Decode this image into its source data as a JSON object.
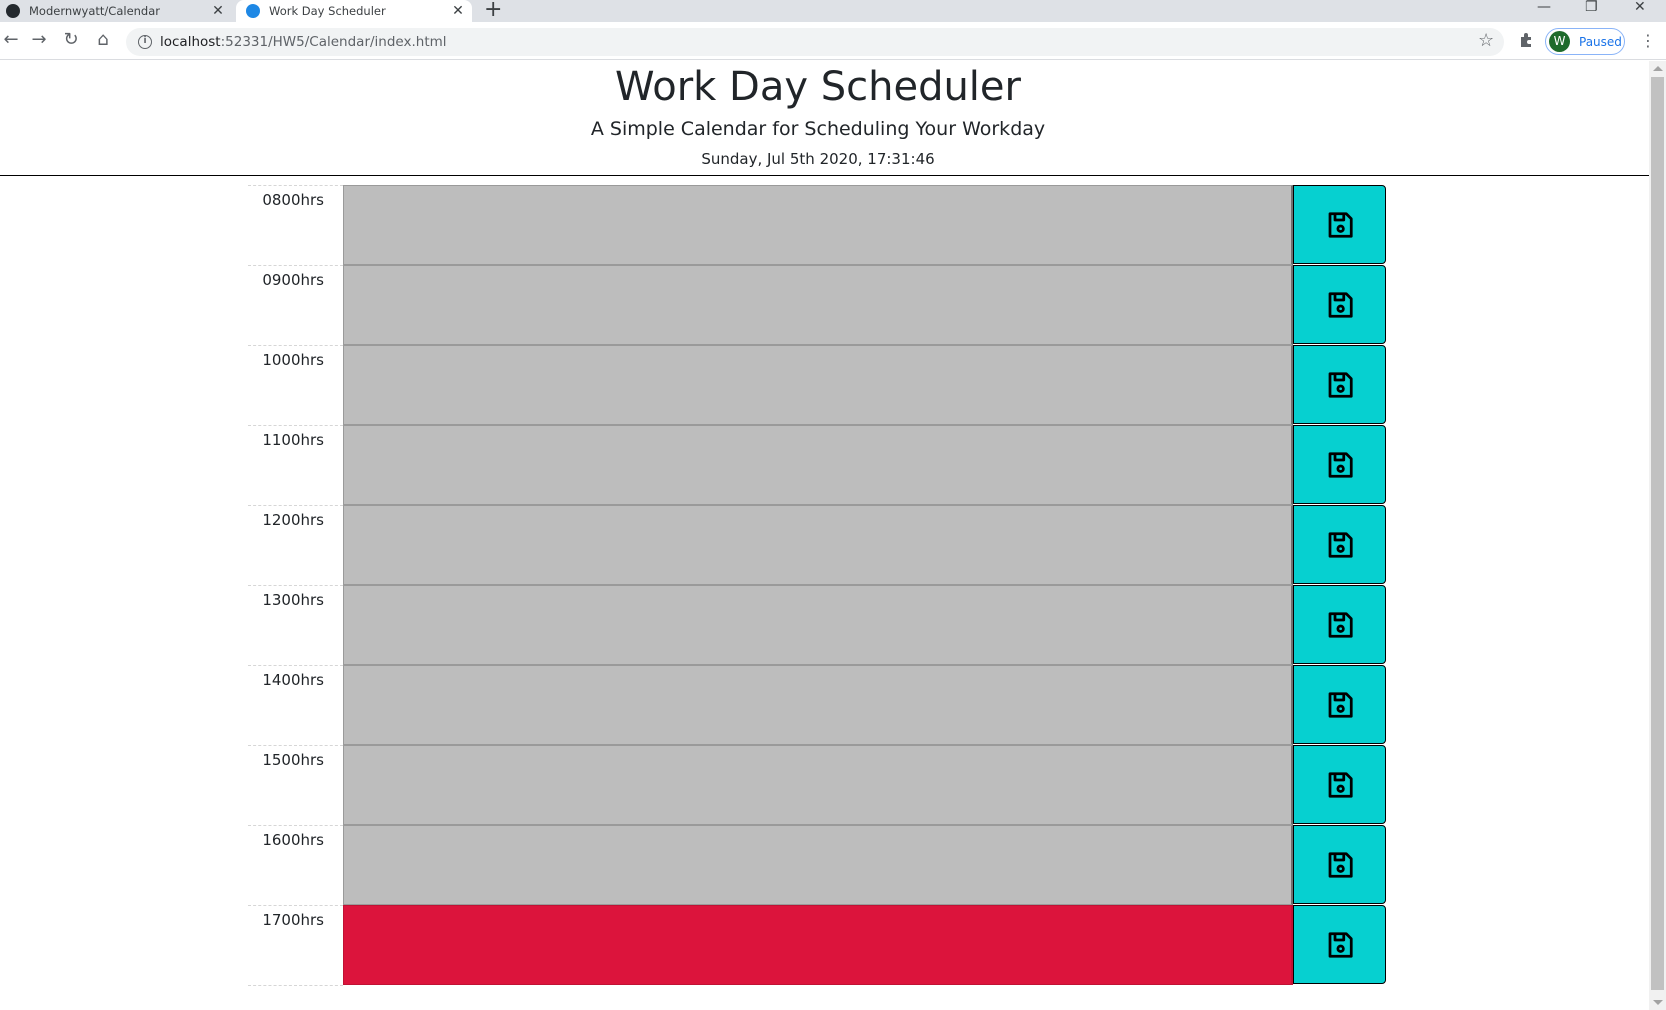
{
  "browser": {
    "tabs": [
      {
        "title": "Modernwyatt/Calendar",
        "icon": "github-icon",
        "active": false
      },
      {
        "title": "Work Day Scheduler",
        "icon": "site-favicon",
        "active": true
      }
    ],
    "url_host": "localhost",
    "url_rest": ":52331/HW5/Calendar/index.html",
    "profile_initial": "W",
    "profile_status": "Paused"
  },
  "page": {
    "title": "Work Day Scheduler",
    "subtitle": "A Simple Calendar for Scheduling Your Workday",
    "current_day": "Sunday, Jul 5th 2020, 17:31:46"
  },
  "hours": [
    {
      "label": "0800hrs",
      "text": "",
      "state": "past"
    },
    {
      "label": "0900hrs",
      "text": "",
      "state": "past"
    },
    {
      "label": "1000hrs",
      "text": "",
      "state": "past"
    },
    {
      "label": "1100hrs",
      "text": "",
      "state": "past"
    },
    {
      "label": "1200hrs",
      "text": "",
      "state": "past"
    },
    {
      "label": "1300hrs",
      "text": "",
      "state": "past"
    },
    {
      "label": "1400hrs",
      "text": "",
      "state": "past"
    },
    {
      "label": "1500hrs",
      "text": "",
      "state": "past"
    },
    {
      "label": "1600hrs",
      "text": "",
      "state": "past"
    },
    {
      "label": "1700hrs",
      "text": "",
      "state": "present"
    }
  ],
  "colors": {
    "past": "#bdbdbd",
    "present": "#dc143c",
    "save_button": "#06d0d0"
  },
  "icons": {
    "save": "floppy-disk-icon"
  }
}
